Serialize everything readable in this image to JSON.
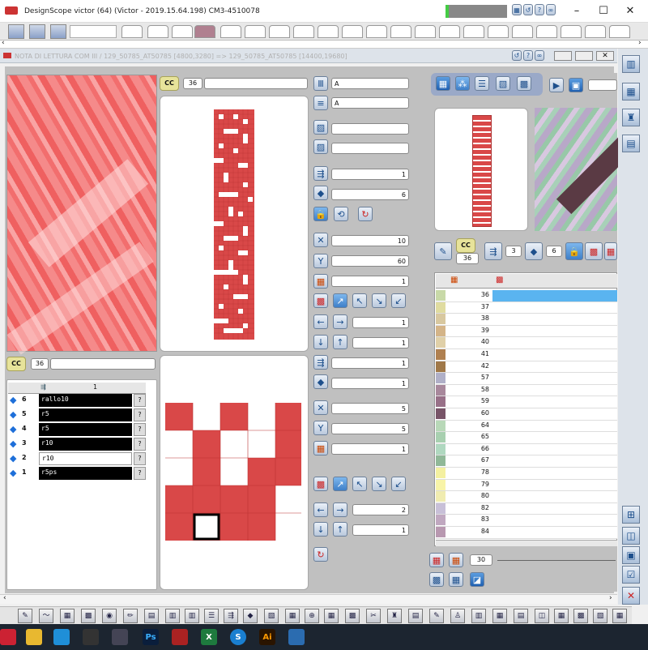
{
  "window": {
    "title": "DesignScope victor (64) (Victor - 2019.15.64.198)  CM3-4510078"
  },
  "subwindow": {
    "title": "NOTA DI LETTURA  COM III  / 129_50785_AT50785 [4800,3280] => 129_50785_AT50785 [14400,19680]"
  },
  "top_panel": {
    "cc_label": "CC",
    "cc_value": "36"
  },
  "bottom_panel": {
    "cc_label": "CC",
    "cc_value": "36"
  },
  "controls": {
    "field_a1": "A",
    "field_a2": "A",
    "val_1": "1",
    "val_6": "6",
    "x_val": "10",
    "y_val": "60",
    "color_val": "1",
    "arrow_h": "1",
    "arrow_v": "1",
    "val_b1": "1",
    "val_b2": "1",
    "x2_val": "5",
    "y2_val": "5",
    "color2_val": "1",
    "arrow2_h": "2",
    "arrow2_v": "1"
  },
  "layers": {
    "header": "1",
    "rows": [
      {
        "num": "6",
        "name": "rallo10",
        "q": "?"
      },
      {
        "num": "5",
        "name": "r5",
        "q": "?"
      },
      {
        "num": "4",
        "name": "r5",
        "q": "?"
      },
      {
        "num": "3",
        "name": "r10",
        "q": "?"
      },
      {
        "num": "2",
        "name": "r10",
        "q": "?"
      },
      {
        "num": "1",
        "name": "r5ps",
        "q": "?"
      }
    ]
  },
  "right_panel": {
    "cc_label": "CC",
    "cc_value": "36",
    "n3": "3",
    "n6": "6",
    "zoom": "30"
  },
  "color_table": {
    "rows": [
      {
        "v": "36",
        "c": "#c8d9a8",
        "sel": true
      },
      {
        "v": "37",
        "c": "#e0dca0"
      },
      {
        "v": "38",
        "c": "#d8c8a0"
      },
      {
        "v": "39",
        "c": "#d4b488"
      },
      {
        "v": "40",
        "c": "#e0d0a8"
      },
      {
        "v": "41",
        "c": "#b08050"
      },
      {
        "v": "42",
        "c": "#a07848"
      },
      {
        "v": "57",
        "c": "#b0b0c8"
      },
      {
        "v": "58",
        "c": "#a8889c"
      },
      {
        "v": "59",
        "c": "#987088"
      },
      {
        "v": "60",
        "c": "#785468"
      },
      {
        "v": "64",
        "c": "#b8d8b8"
      },
      {
        "v": "65",
        "c": "#a8d0b0"
      },
      {
        "v": "66",
        "c": "#b0d8c0"
      },
      {
        "v": "67",
        "c": "#90b898"
      },
      {
        "v": "78",
        "c": "#f4f0a0"
      },
      {
        "v": "79",
        "c": "#f8f4a8"
      },
      {
        "v": "80",
        "c": "#f0ecb0"
      },
      {
        "v": "82",
        "c": "#c8c0d8"
      },
      {
        "v": "83",
        "c": "#c0a8c0"
      },
      {
        "v": "84",
        "c": "#b898b0"
      }
    ]
  },
  "colors": {
    "accent_red": "#d94848",
    "cc_yellow": "#e7e39a",
    "select_blue": "#5ab4f0"
  }
}
